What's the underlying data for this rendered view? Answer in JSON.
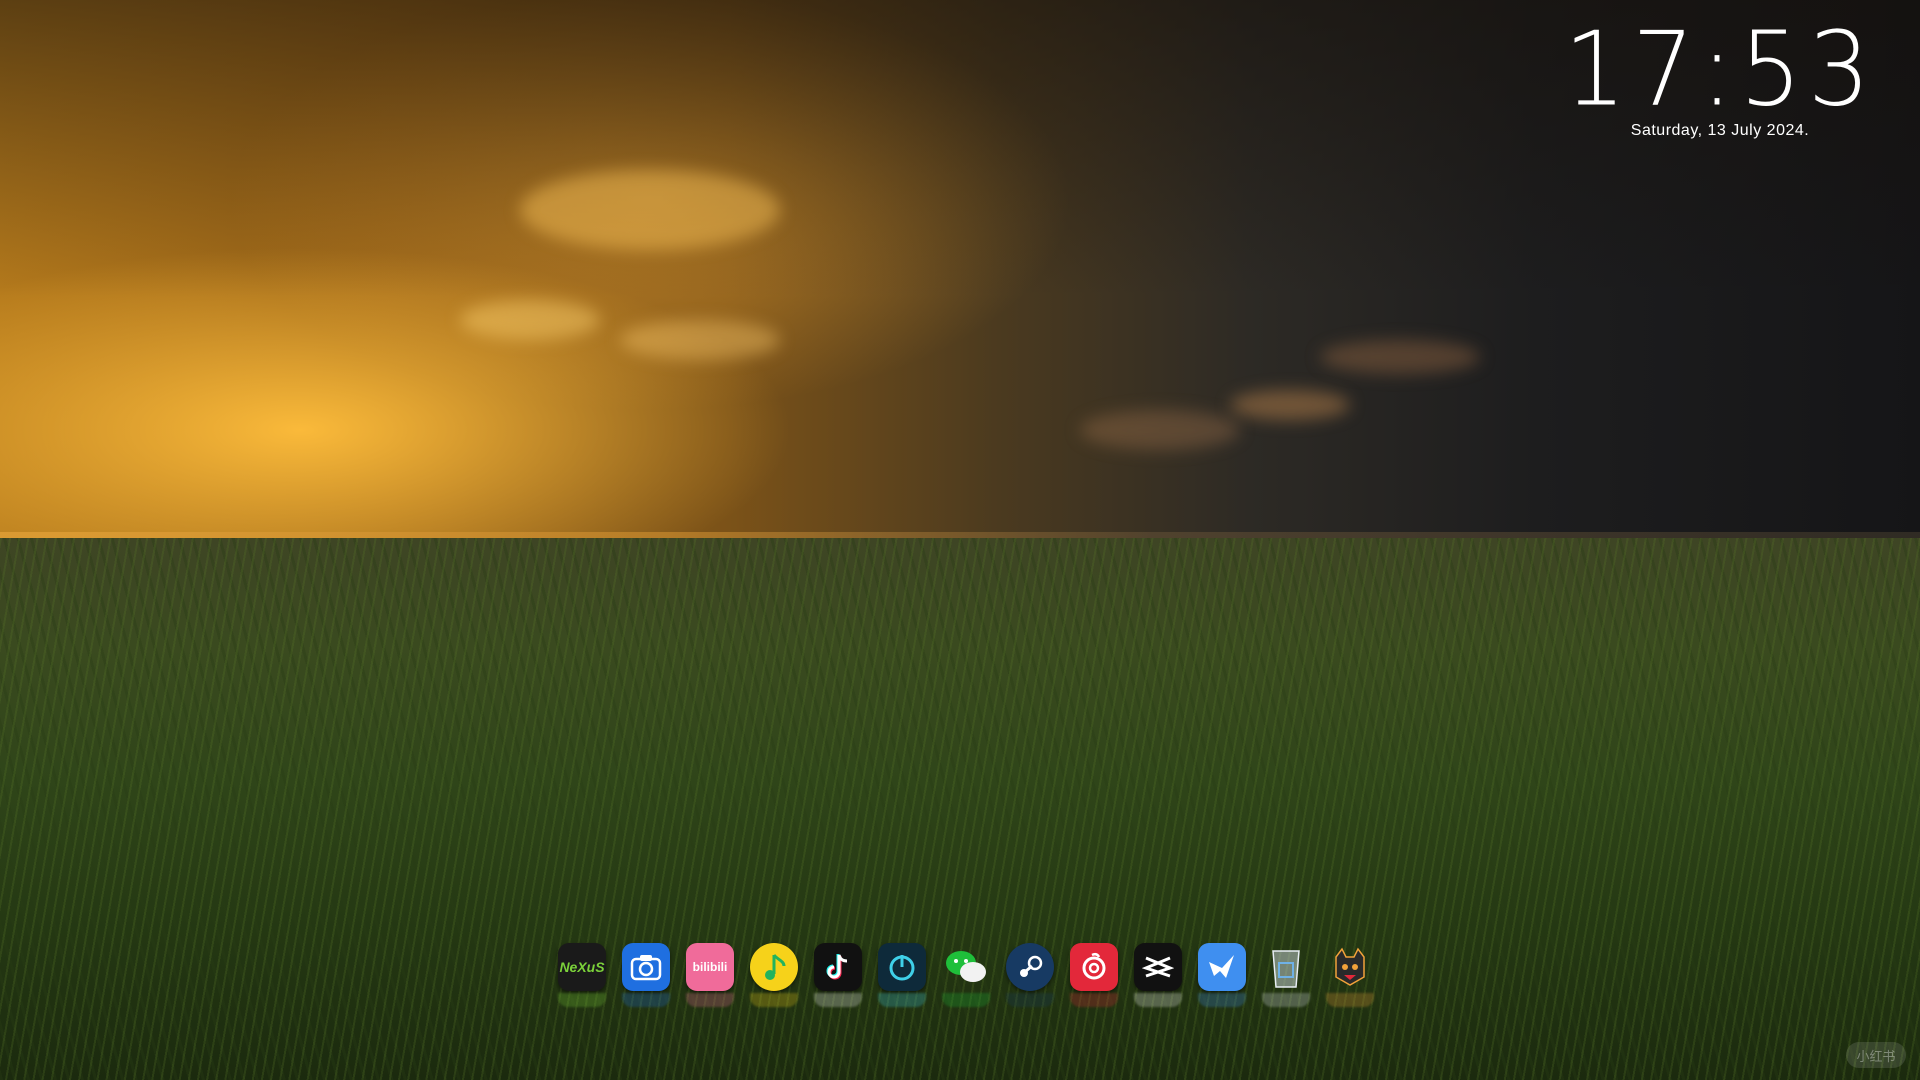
{
  "desktop": {
    "clock": {
      "time": "17:53",
      "date": "Saturday, 13 July 2024."
    },
    "dock": {
      "apps": [
        {
          "name": "Nexus",
          "label": "NeXuS",
          "icon": "nexus-icon",
          "bg": "#1a1a1a",
          "fg": "#7bd13a"
        },
        {
          "name": "Screenshot",
          "label": "",
          "icon": "camera-icon",
          "bg": "#1f6fe0",
          "fg": "#ffffff"
        },
        {
          "name": "Bilibili",
          "label": "bilibili",
          "icon": "bilibili-icon",
          "bg": "#f06b9a",
          "fg": "#ffffff"
        },
        {
          "name": "QQ Music",
          "label": "",
          "icon": "music-note-icon",
          "bg": "#f6d21a",
          "fg": "#22b35d"
        },
        {
          "name": "TikTok",
          "label": "",
          "icon": "tiktok-icon",
          "bg": "#111111",
          "fg": "#ffffff"
        },
        {
          "name": "Focus",
          "label": "",
          "icon": "power-ring-icon",
          "bg": "#0e2a3a",
          "fg": "#3fd0e8"
        },
        {
          "name": "WeChat",
          "label": "",
          "icon": "wechat-icon",
          "bg": "#1fbf3a",
          "fg": "#ffffff"
        },
        {
          "name": "Steam",
          "label": "",
          "icon": "steam-icon",
          "bg": "#173a63",
          "fg": "#ffffff"
        },
        {
          "name": "NetEase Music",
          "label": "",
          "icon": "netease-music-icon",
          "bg": "#e3283a",
          "fg": "#ffffff"
        },
        {
          "name": "CapCut",
          "label": "",
          "icon": "capcut-icon",
          "bg": "#111111",
          "fg": "#ffffff"
        },
        {
          "name": "Feishu",
          "label": "",
          "icon": "bird-icon",
          "bg": "#3f8ff0",
          "fg": "#ffffff"
        },
        {
          "name": "Recycle Bin",
          "label": "",
          "icon": "recycle-bin-icon",
          "bg": "rgba(210,220,230,0.35)",
          "fg": "#e8eef5"
        },
        {
          "name": "Game",
          "label": "",
          "icon": "mascot-icon",
          "bg": "#2a2a2a",
          "fg": "#f2a23a"
        }
      ]
    },
    "watermark": "小红书"
  }
}
